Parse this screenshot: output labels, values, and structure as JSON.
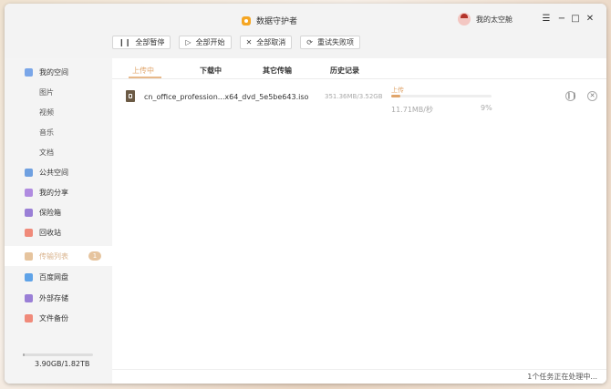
{
  "app": {
    "title": "数据守护者",
    "user_name": "我的太空舱"
  },
  "window_controls": {
    "menu": "☰",
    "minimize": "−",
    "maximize": "□",
    "close": "✕"
  },
  "toolbar": {
    "pause_all": {
      "icon": "pause-icon",
      "glyph": "❙❙",
      "label": "全部暂停"
    },
    "start_all": {
      "icon": "play-icon",
      "glyph": "▷",
      "label": "全部开始"
    },
    "cancel_all": {
      "icon": "close-icon",
      "glyph": "✕",
      "label": "全部取消"
    },
    "retry_failed": {
      "icon": "refresh-icon",
      "glyph": "⟳",
      "label": "重试失败项"
    }
  },
  "sidebar": {
    "items": [
      {
        "label": "我的空间",
        "icon_color": "#7aa6e8"
      },
      {
        "label": "图片"
      },
      {
        "label": "视频"
      },
      {
        "label": "音乐"
      },
      {
        "label": "文档"
      },
      {
        "label": "公共空间",
        "icon_color": "#6fa0e0"
      },
      {
        "label": "我的分享",
        "icon_color": "#b08be0"
      },
      {
        "label": "保险箱",
        "icon_color": "#9a7fd6"
      },
      {
        "label": "回收站",
        "icon_color": "#f08a7a"
      },
      {
        "label": "传输列表",
        "icon_color": "#e6c49e",
        "badge": "1"
      },
      {
        "label": "百度网盘",
        "icon_color": "#5fa3e8"
      },
      {
        "label": "外部存储",
        "icon_color": "#9a7fd6"
      },
      {
        "label": "文件备份",
        "icon_color": "#f08a7a"
      }
    ],
    "storage": {
      "text": "3.90GB/1.82TB",
      "used_fraction": 0.002
    }
  },
  "tabs": [
    "上传中",
    "下载中",
    "其它传输",
    "历史记录"
  ],
  "transfers": [
    {
      "filename": "cn_office_profession...x64_dvd_5e5be643.iso",
      "size": "351.36MB/3.52GB",
      "status": "上传",
      "speed": "11.71MB/秒",
      "percent": "9%",
      "progress": 0.09
    }
  ],
  "footer": {
    "status": "1个任务正在处理中..."
  },
  "colors": {
    "accent": "#e0a56b",
    "sidebar_bg": "#f4f4f4",
    "titlebar_bg": "#f3f3f3"
  }
}
